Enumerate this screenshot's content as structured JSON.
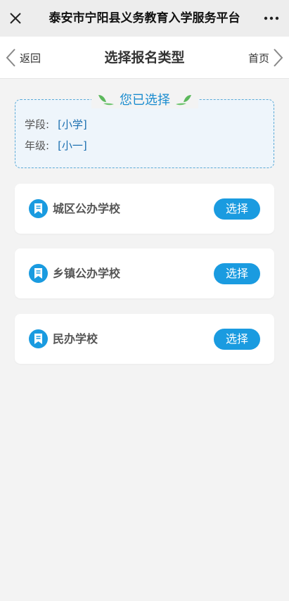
{
  "wechat_bar": {
    "title": "泰安市宁阳县义务教育入学服务平台"
  },
  "nav": {
    "back_label": "返回",
    "title": "选择报名类型",
    "home_label": "首页"
  },
  "selection": {
    "heading": "您已选择",
    "stage_label": "学段:",
    "stage_value": "[小学]",
    "grade_label": "年级:",
    "grade_value": "[小一]"
  },
  "options": [
    {
      "label": "城区公办学校",
      "button": "选择"
    },
    {
      "label": "乡镇公办学校",
      "button": "选择"
    },
    {
      "label": "民办学校",
      "button": "选择"
    }
  ],
  "colors": {
    "accent": "#1a9be0",
    "heading_blue": "#1a8ccf",
    "leaf_green": "#5cb85c"
  }
}
